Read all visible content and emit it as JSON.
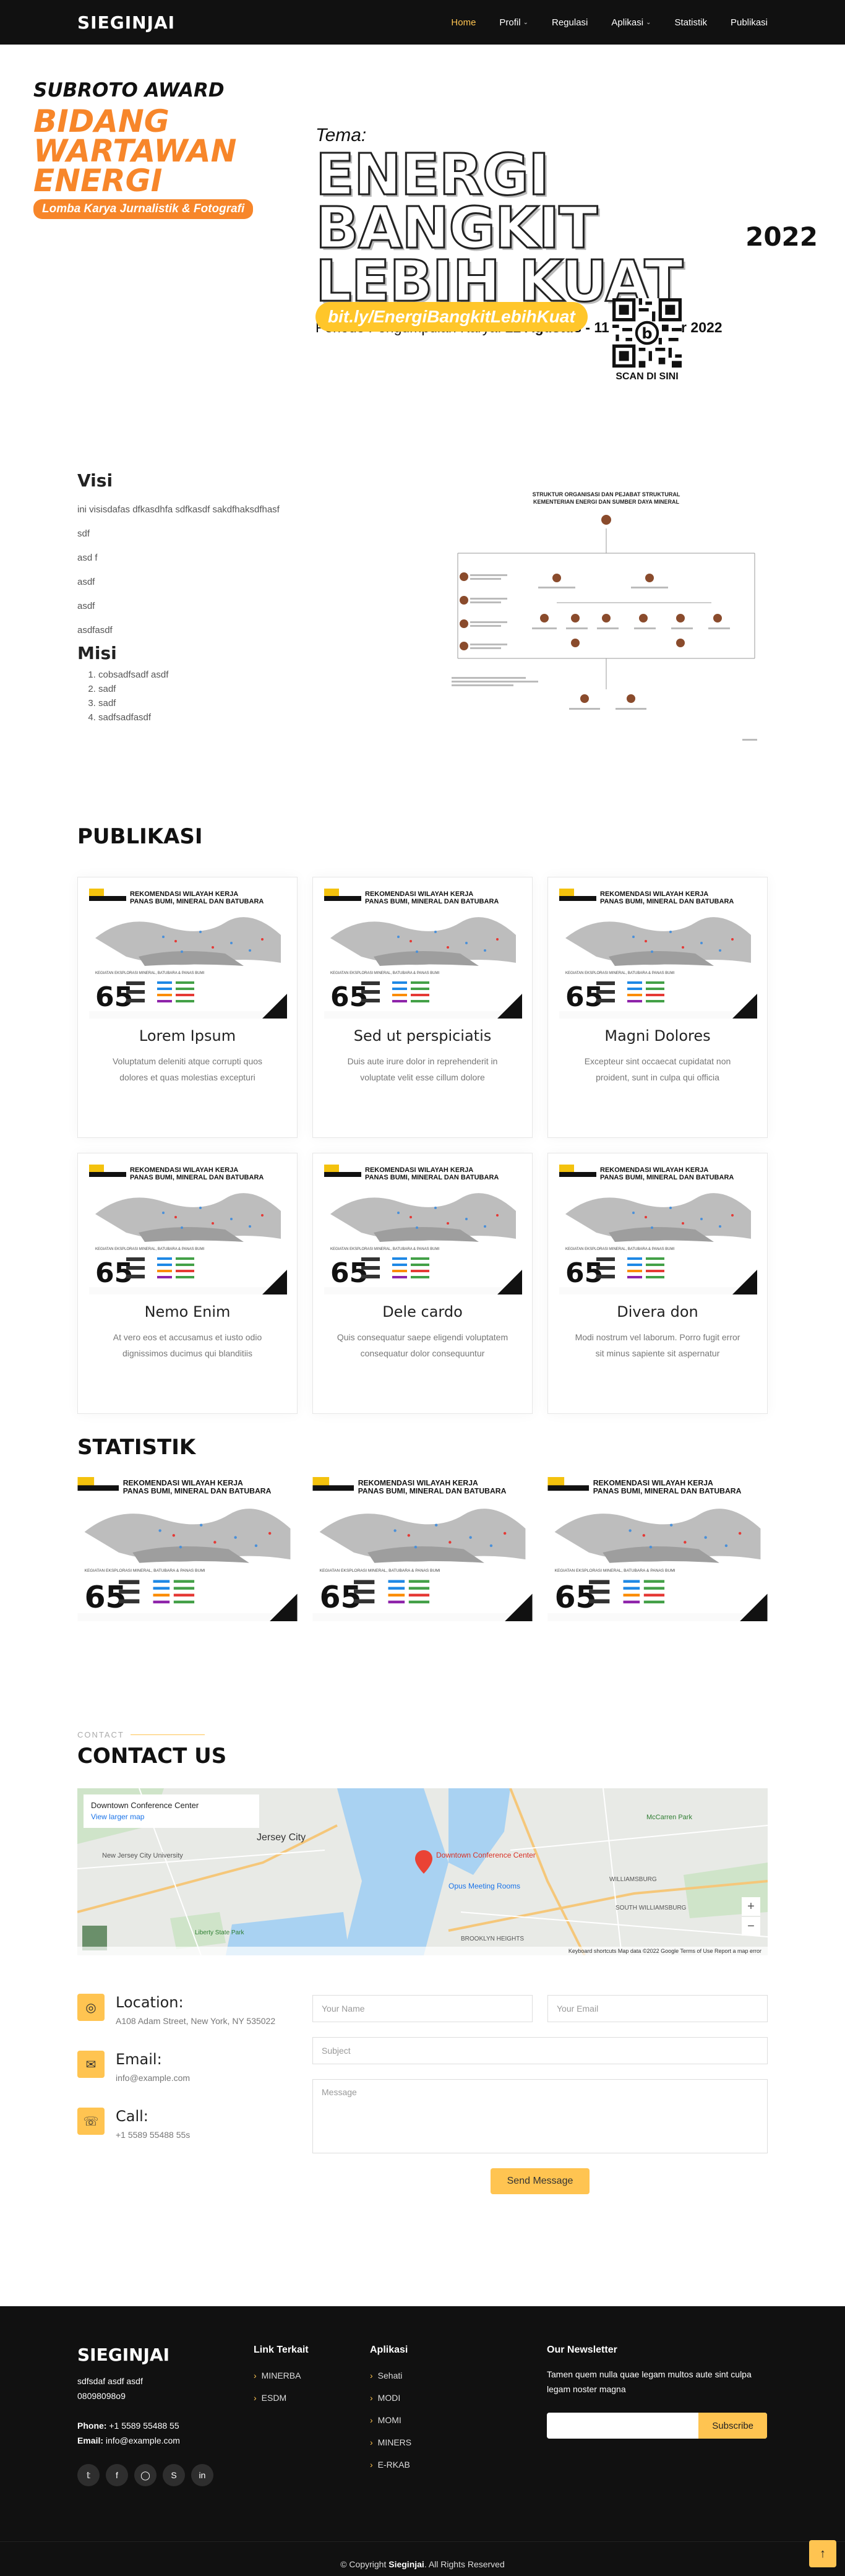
{
  "header": {
    "logo": "SIEGINJAI",
    "nav": [
      {
        "label": "Home",
        "active": true,
        "dropdown": false
      },
      {
        "label": "Profil",
        "active": false,
        "dropdown": true
      },
      {
        "label": "Regulasi",
        "active": false,
        "dropdown": false
      },
      {
        "label": "Aplikasi",
        "active": false,
        "dropdown": true
      },
      {
        "label": "Statistik",
        "active": false,
        "dropdown": false
      },
      {
        "label": "Publikasi",
        "active": false,
        "dropdown": false
      }
    ]
  },
  "hero": {
    "award": "SUBROTO AWARD",
    "bidang": [
      "BIDANG",
      "WARTAWAN",
      "ENERGI"
    ],
    "badge": "Lomba Karya Jurnalistik & Fotografi",
    "year": "2022",
    "tema_label": "Tema:",
    "tema_lines": [
      "ENERGI BANGKIT",
      "LEBIH KUAT"
    ],
    "periode_prefix": "Periode Pengumpulan Karya:",
    "periode_dates": "22 Agustus - 11 September 2022",
    "link": "bit.ly/EnergiBangkitLebihKuat",
    "scan": "SCAN DI SINI"
  },
  "about": {
    "visi_title": "Visi",
    "visi_lines": [
      "ini visisdafas dfkasdhfa sdfkasdf sakdfhaksdfhasf",
      "sdf",
      "asd f",
      "asdf",
      "asdf",
      "asdfasdf"
    ],
    "misi_title": "Misi",
    "misi_items": [
      "cobsadfsadf asdf",
      "sadf",
      "sadf",
      "sadfsadfasdf"
    ],
    "org_chart": {
      "title": "STRUKTUR ORGANISASI DAN PEJABAT STRUKTURAL",
      "subtitle": "KEMENTERIAN ENERGI DAN SUMBER DAYA MINERAL"
    }
  },
  "publikasi": {
    "title": "PUBLIKASI",
    "cards": [
      {
        "title": "Lorem Ipsum",
        "text": "Voluptatum deleniti atque corrupti quos dolores et quas molestias excepturi"
      },
      {
        "title": "Sed ut perspiciatis",
        "text": "Duis aute irure dolor in reprehenderit in voluptate velit esse cillum dolore"
      },
      {
        "title": "Magni Dolores",
        "text": "Excepteur sint occaecat cupidatat non proident, sunt in culpa qui officia"
      },
      {
        "title": "Nemo Enim",
        "text": "At vero eos et accusamus et iusto odio dignissimos ducimus qui blanditiis"
      },
      {
        "title": "Dele cardo",
        "text": "Quis consequatur saepe eligendi voluptatem consequatur dolor consequuntur"
      },
      {
        "title": "Divera don",
        "text": "Modi nostrum vel laborum. Porro fugit error sit minus sapiente sit aspernatur"
      }
    ],
    "poster": {
      "title_line1": "REKOMENDASI WILAYAH KERJA",
      "title_line2": "PANAS BUMI, MINERAL DAN BATUBARA",
      "kegiatan": "KEGIATAN EKSPLORASI MINERAL, BATUBARA & PANAS BUMI",
      "big_number": "65"
    }
  },
  "statistik": {
    "title": "STATISTIK"
  },
  "contact": {
    "small": "CONTACT",
    "title": "CONTACT US",
    "map": {
      "place": "Downtown Conference Center",
      "view_larger": "View larger map",
      "labels": [
        "Jersey City",
        "New Jersey City University",
        "Downtown Conference Center",
        "Opus Meeting Rooms",
        "WILLIAMSBURG",
        "SOUTH WILLIAMSBURG",
        "BROOKLYN HEIGHTS",
        "Liberty State Park",
        "McCarren Park"
      ],
      "footer": "Keyboard shortcuts   Map data ©2022 Google   Terms of Use   Report a map error"
    },
    "location_title": "Location:",
    "location": "A108 Adam Street, New York, NY 535022",
    "email_title": "Email:",
    "email": "info@example.com",
    "call_title": "Call:",
    "call": "+1 5589 55488 55s",
    "form": {
      "name": "Your Name",
      "email": "Your Email",
      "subject": "Subject",
      "message": "Message",
      "send": "Send Message"
    }
  },
  "footer": {
    "brand": "SIEGINJAI",
    "addr1": "sdfsdaf asdf asdf",
    "addr2": "08098098o9",
    "phone_label": "Phone:",
    "phone": "+1 5589 55488 55",
    "email_label": "Email:",
    "email": "info@example.com",
    "link_title": "Link Terkait",
    "links": [
      "MINERBA",
      "ESDM"
    ],
    "apps_title": "Aplikasi",
    "apps": [
      "Sehati",
      "MODI",
      "MOMI",
      "MINERS",
      "E-RKAB"
    ],
    "news_title": "Our Newsletter",
    "news_text": "Tamen quem nulla quae legam multos aute sint culpa legam noster magna",
    "subscribe": "Subscribe",
    "copyright_prefix": "© Copyright",
    "copyright_brand": "Sieginjai",
    "copyright_suffix": ". All Rights Reserved"
  },
  "colors": {
    "accent": "#ffc451",
    "orange": "#f7862a",
    "dark": "#111111"
  }
}
